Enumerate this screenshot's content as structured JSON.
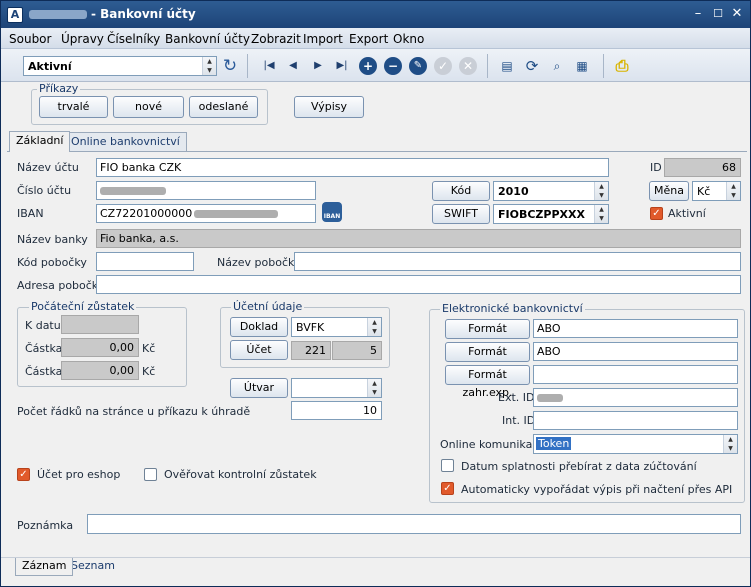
{
  "window": {
    "title": "- Bankovní účty",
    "app_icon": "A"
  },
  "menu": [
    "Soubor",
    "Úpravy",
    "Číselníky",
    "Bankovní účty",
    "Zobrazit",
    "Import",
    "Export",
    "Okno"
  ],
  "toolbar": {
    "filter": "Aktivní"
  },
  "prikazy": {
    "label": "Příkazy",
    "trvale": "trvalé",
    "nove": "nové",
    "odeslane": "odeslané",
    "vypisy": "Výpisy"
  },
  "tabs": [
    "Základní",
    "Online bankovnictví"
  ],
  "form": {
    "nazev_uctu_label": "Název účtu",
    "nazev_uctu": "FIO banka CZK",
    "id_label": "ID",
    "id": "68",
    "cislo_uctu_label": "Číslo účtu",
    "kod_banky_btn": "Kód banky",
    "kod_banky": "2010",
    "mena_btn": "Měna",
    "mena": "Kč",
    "iban_label": "IBAN",
    "iban": "CZ72201000000",
    "swift_btn": "SWIFT",
    "swift": "FIOBCZPPXXX",
    "aktivni_label": "Aktivní",
    "nazev_banky_label": "Název banky",
    "nazev_banky": "Fio banka, a.s.",
    "kod_pobocky_label": "Kód pobočky",
    "nazev_pobocky_label": "Název pobočky",
    "adresa_pobocky_label": "Adresa pobočky"
  },
  "pocatecni": {
    "label": "Počáteční zůstatek",
    "k_datu": "K datu",
    "castka1_label": "Částka",
    "castka1": "0,00",
    "mena1": "Kč",
    "castka2_label": "Částka",
    "castka2": "0,00",
    "mena2": "Kč"
  },
  "ucetni": {
    "label": "Účetní údaje",
    "doklad_btn": "Doklad",
    "doklad": "BVFK",
    "ucet_btn": "Účet",
    "ucet1": "221",
    "ucet2": "5",
    "utvar_btn": "Útvar"
  },
  "pocet_radku_label": "Počet řádků na stránce u příkazu k úhradě",
  "pocet_radku": "10",
  "eshop_label": "Účet pro eshop",
  "overovat_label": "Ověřovat kontrolní zůstatek",
  "elektronicke": {
    "label": "Elektronické bankovnictví",
    "format_importu_btn": "Formát importu",
    "format_importu": "ABO",
    "format_exportu_btn": "Formát exportu",
    "format_exportu": "ABO",
    "format_zahr_btn": "Formát zahr.exp.",
    "ext_id_label": "Ext. ID",
    "int_id_label": "Int. ID",
    "online_label": "Online komunikace",
    "online_value": "Token",
    "datum_splatnosti_label": "Datum splatnosti přebírat z data zúčtování",
    "auto_label": "Automaticky vypořádat výpis při načtení přes API"
  },
  "poznamka_label": "Poznámka",
  "bottom_tabs": [
    "Záznam",
    "Seznam"
  ]
}
